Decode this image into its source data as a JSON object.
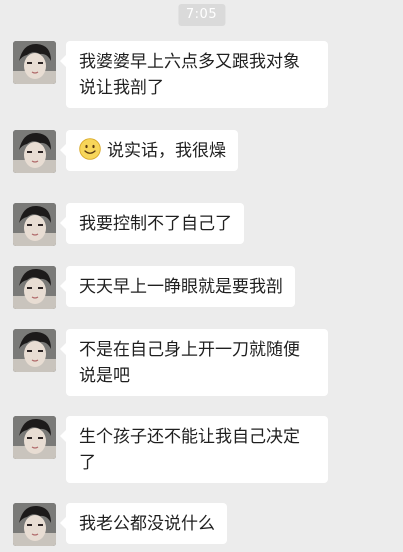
{
  "chat": {
    "timestamp": "7:05",
    "messages": [
      {
        "text": "我婆婆早上六点多又跟我对象说让我剖了"
      },
      {
        "icon": "smile-emoji-icon",
        "text": "说实话，我很燥"
      },
      {
        "text": "我要控制不了自己了"
      },
      {
        "text": "天天早上一睁眼就是要我剖"
      },
      {
        "text": "不是在自己身上开一刀就随便说是吧"
      },
      {
        "text": "生个孩子还不能让我自己决定了"
      },
      {
        "text": "我老公都没说什么"
      }
    ]
  },
  "colors": {
    "background": "#ececec",
    "bubble": "#ffffff",
    "timestamp_bg": "#dadada",
    "text": "#1f1f1f"
  }
}
